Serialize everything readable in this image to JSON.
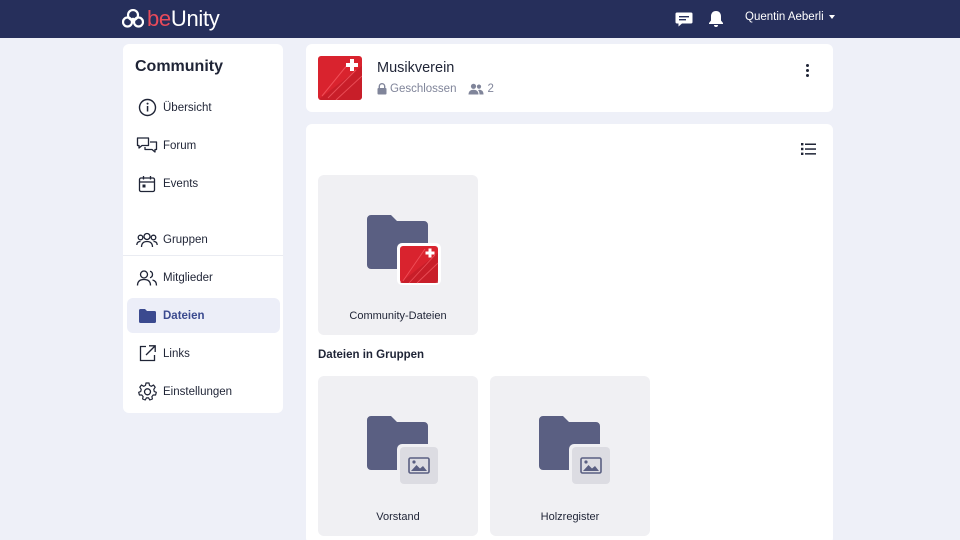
{
  "app": {
    "logo_text_be": "be",
    "logo_text_unity": "Unity",
    "user_name": "Quentin Aeberli",
    "icons": {
      "chat": "chat-icon",
      "notifications": "bell-icon",
      "menu": "caret-down-icon"
    }
  },
  "sidebar": {
    "title": "Community",
    "items": [
      {
        "label": "Übersicht",
        "icon": "info-circle-icon",
        "active": false
      },
      {
        "label": "Forum",
        "icon": "forum-icon",
        "active": false
      },
      {
        "label": "Events",
        "icon": "calendar-icon",
        "active": false
      },
      {
        "label": "Gruppen",
        "icon": "groups-icon",
        "active": false
      },
      {
        "label": "Mitglieder",
        "icon": "members-icon",
        "active": false
      },
      {
        "label": "Dateien",
        "icon": "folder-icon",
        "active": true
      },
      {
        "label": "Links",
        "icon": "external-link-icon",
        "active": false
      },
      {
        "label": "Einstellungen",
        "icon": "gear-icon",
        "active": false
      }
    ]
  },
  "community": {
    "name": "Musikverein",
    "visibility": "Geschlossen",
    "member_count": "2"
  },
  "files": {
    "community_folder_label": "Community-Dateien",
    "groups_section_title": "Dateien in Gruppen",
    "group_folders": [
      {
        "label": "Vorstand"
      },
      {
        "label": "Holzregister"
      }
    ]
  },
  "colors": {
    "topbar": "#262f5b",
    "brand_accent": "#e84a5a",
    "folder": "#5a5f82",
    "swiss_red": "#d9232e",
    "active_nav_bg": "#eceef8",
    "active_nav_text": "#3b4a8f"
  }
}
